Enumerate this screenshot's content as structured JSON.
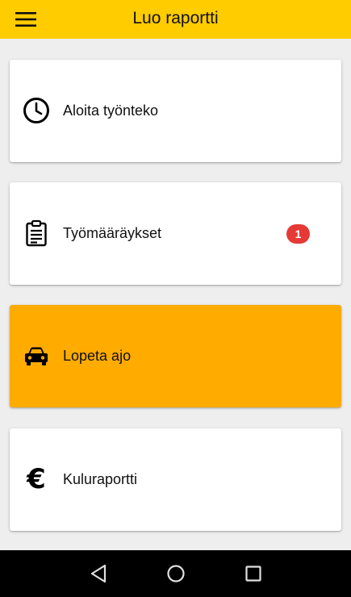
{
  "app_bar": {
    "title": "Luo raportti",
    "menu_icon": "hamburger-menu-icon",
    "background_color": "#ffcc00"
  },
  "cards": [
    {
      "label": "Aloita työnteko",
      "icon": "clock-icon",
      "active": false
    },
    {
      "label": "Työmääräykset",
      "icon": "clipboard-icon",
      "active": false,
      "badge": "1"
    },
    {
      "label": "Lopeta ajo",
      "icon": "car-icon",
      "active": true
    },
    {
      "label": "Kuluraportti",
      "icon": "euro-icon",
      "active": false,
      "icon_glyph": "€"
    }
  ],
  "colors": {
    "active_card": "#ffab00",
    "badge": "#e53935",
    "nav_bar": "#000000"
  },
  "nav_bar": {
    "buttons": [
      "back-icon",
      "home-icon",
      "recents-icon"
    ]
  }
}
